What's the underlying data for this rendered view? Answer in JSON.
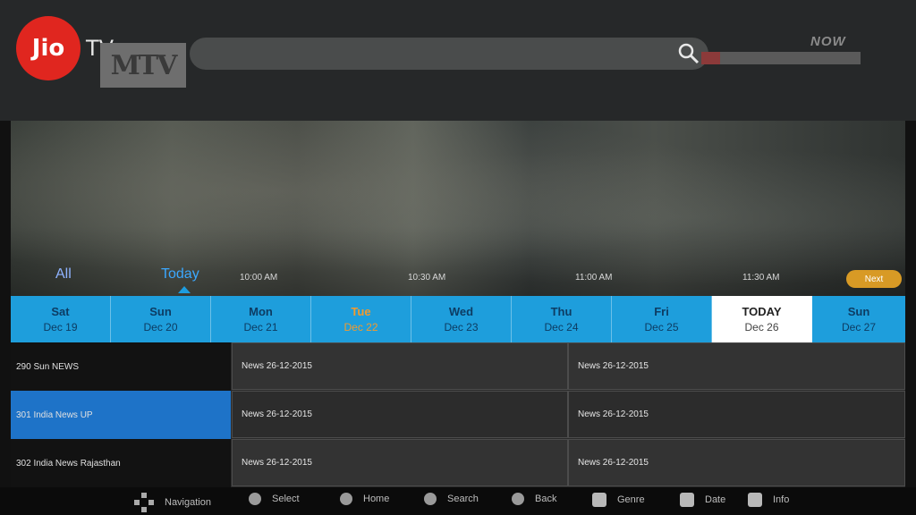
{
  "header": {
    "brand": "Jio",
    "brand_suffix": "TV",
    "channel_logo": "MTV",
    "search_placeholder": "",
    "now_label": "NOW",
    "now_progress": 0.12
  },
  "tabs": {
    "all": "All",
    "today": "Today"
  },
  "timeline": {
    "times": [
      "10:00 AM",
      "10:30 AM",
      "11:00 AM",
      "11:30 AM"
    ],
    "next_label": "Next"
  },
  "days": [
    {
      "name": "Sat",
      "date": "Dec 19"
    },
    {
      "name": "Sun",
      "date": "Dec 20"
    },
    {
      "name": "Mon",
      "date": "Dec 21"
    },
    {
      "name": "Tue",
      "date": "Dec 22"
    },
    {
      "name": "Wed",
      "date": "Dec 23"
    },
    {
      "name": "Thu",
      "date": "Dec 24"
    },
    {
      "name": "Fri",
      "date": "Dec 25"
    },
    {
      "name": "TODAY",
      "date": "Dec 26"
    },
    {
      "name": "Sun",
      "date": "Dec 27"
    }
  ],
  "channels": [
    {
      "label": "290  Sun NEWS"
    },
    {
      "label": "301  India News UP"
    },
    {
      "label": "302  India News Rajasthan"
    }
  ],
  "programs": [
    [
      "News 26-12-2015",
      "News 26-12-2015"
    ],
    [
      "News 26-12-2015",
      "News 26-12-2015"
    ],
    [
      "News 26-12-2015",
      "News 26-12-2015"
    ]
  ],
  "hints": [
    {
      "label": "Navigation"
    },
    {
      "label": "Select"
    },
    {
      "label": "Home"
    },
    {
      "label": "Search"
    },
    {
      "label": "Back"
    },
    {
      "label": "Genre"
    },
    {
      "label": "Date"
    },
    {
      "label": "Info"
    }
  ],
  "colors": {
    "accent": "#1e9edc",
    "brand_red": "#e0261f",
    "highlight_channel": "#1e73c8",
    "next_button": "#d89a25"
  }
}
